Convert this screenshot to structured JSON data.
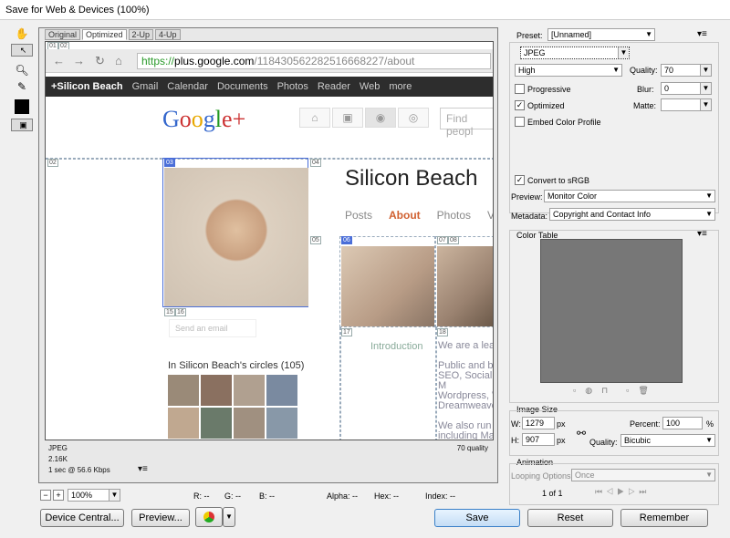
{
  "window": {
    "title": "Save for Web & Devices (100%)"
  },
  "view_tabs": [
    "Original",
    "Optimized",
    "2-Up",
    "4-Up"
  ],
  "browser": {
    "url_https": "https://",
    "url_host": "plus.google.com",
    "url_path": "/118430562282516668227/about"
  },
  "gbar": {
    "items": [
      "+Silicon Beach",
      "Gmail",
      "Calendar",
      "Documents",
      "Photos",
      "Reader",
      "Web",
      "more"
    ]
  },
  "page": {
    "logo": "Google+",
    "find_placeholder": "Find peopl",
    "name": "Silicon Beach",
    "tabs": [
      "Posts",
      "About",
      "Photos",
      "V"
    ],
    "send_email": "Send an email",
    "circles": "In Silicon Beach's circles (105)",
    "intro": "Introduction",
    "bio": [
      "We are a lead",
      "",
      "Public and be",
      "SEO, Social M",
      "Wordpress, W",
      "Dreamweaver,",
      "",
      "We also run a",
      "including Mac"
    ]
  },
  "slices": [
    "01",
    "02",
    "03",
    "04",
    "05",
    "06",
    "07",
    "08",
    "15",
    "16",
    "17",
    "18"
  ],
  "info": {
    "format": "JPEG",
    "size": "2.16K",
    "time": "1 sec @ 56.6 Kbps",
    "quality": "70 quality"
  },
  "settings": {
    "preset_label": "Preset:",
    "preset_value": "[Unnamed]",
    "format": "JPEG",
    "compression": "High",
    "quality_label": "Quality:",
    "quality_value": "70",
    "progressive": "Progressive",
    "blur_label": "Blur:",
    "blur_value": "0",
    "optimized": "Optimized",
    "matte_label": "Matte:",
    "embed_profile": "Embed Color Profile",
    "convert_srgb": "Convert to sRGB",
    "preview_label": "Preview:",
    "preview_value": "Monitor Color",
    "metadata_label": "Metadata:",
    "metadata_value": "Copyright and Contact Info",
    "color_table": "Color Table",
    "image_size": "Image Size",
    "w_label": "W:",
    "w_value": "1279",
    "h_label": "H:",
    "h_value": "907",
    "px": "px",
    "percent_label": "Percent:",
    "percent_value": "100",
    "pct": "%",
    "quality2_label": "Quality:",
    "quality2_value": "Bicubic",
    "animation": "Animation",
    "looping_label": "Looping Options:",
    "looping_value": "Once",
    "frame_counter": "1 of 1"
  },
  "status": {
    "zoom": "100%",
    "r": "R: --",
    "g": "G: --",
    "b": "B: --",
    "alpha": "Alpha: --",
    "hex": "Hex: --",
    "index": "Index: --"
  },
  "buttons": {
    "device_central": "Device Central...",
    "preview": "Preview...",
    "save": "Save",
    "reset": "Reset",
    "remember": "Remember"
  }
}
